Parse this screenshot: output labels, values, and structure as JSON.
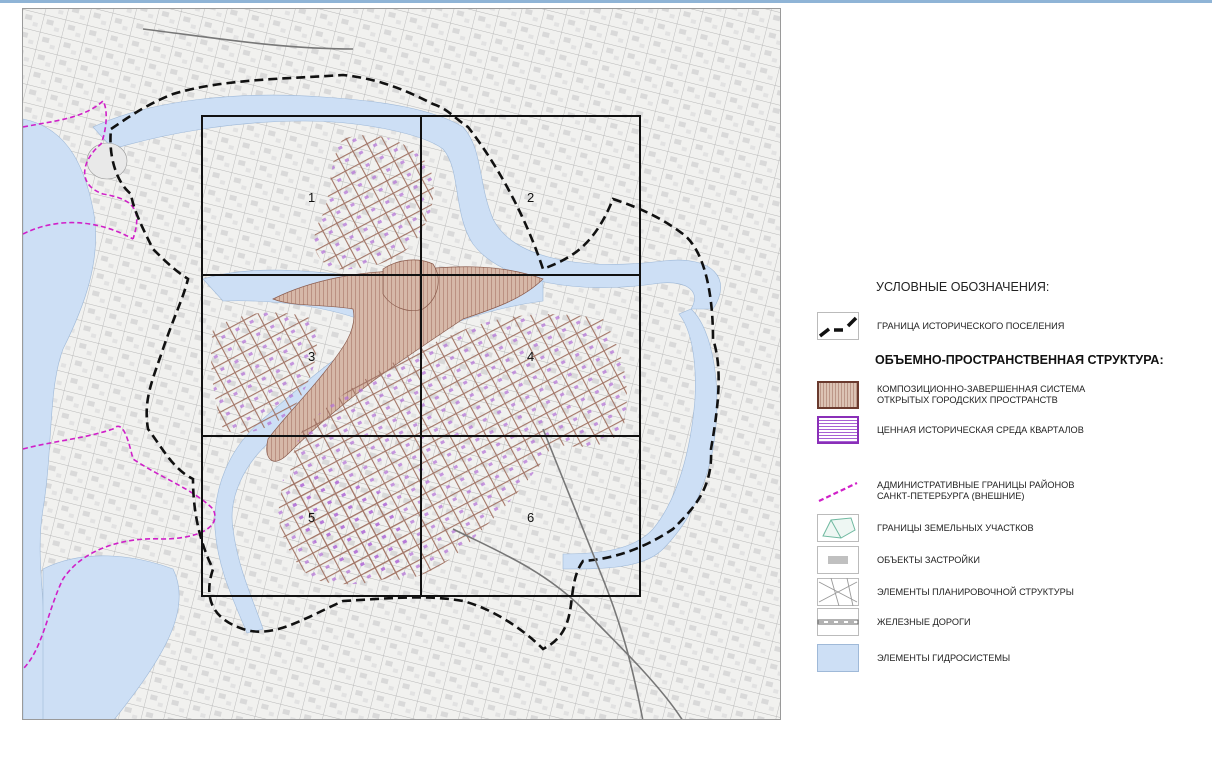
{
  "legend": {
    "title": "УСЛОВНЫЕ ОБОЗНАЧЕНИЯ:",
    "historic_boundary": "ГРАНИЦА ИСТОРИЧЕСКОГО ПОСЕЛЕНИЯ",
    "structure_heading": "ОБЪЕМНО-ПРОСТРАНСТВЕННАЯ СТРУКТУРА:",
    "open_spaces_line1": "КОМПОЗИЦИОННО-ЗАВЕРШЕННАЯ СИСТЕМА",
    "open_spaces_line2": "ОТКРЫТЫХ ГОРОДСКИХ ПРОСТРАНСТВ",
    "historic_blocks": "ЦЕННАЯ ИСТОРИЧЕСКАЯ СРЕДА КВАРТАЛОВ",
    "admin_line1": "АДМИНИСТРАТИВНЫЕ ГРАНИЦЫ РАЙОНОВ",
    "admin_line2": "САНКТ-ПЕТЕРБУРГА (ВНЕШНИЕ)",
    "land_plots": "ГРАНИЦЫ ЗЕМЕЛЬНЫХ УЧАСТКОВ",
    "buildings": "ОБЪЕКТЫ ЗАСТРОЙКИ",
    "planning": "ЭЛЕМЕНТЫ ПЛАНИРОВОЧНОЙ СТРУКТУРЫ",
    "railways": "ЖЕЛЕЗНЫЕ ДОРОГИ",
    "hydro": "ЭЛЕМЕНТЫ ГИДРОСИСТЕМЫ"
  },
  "map": {
    "grid_labels": [
      "1",
      "2",
      "3",
      "4",
      "5",
      "6"
    ]
  },
  "colors": {
    "water": "#cddff5",
    "open_space": "#b98a78",
    "historic_blocks": "#8a2fb8",
    "admin_boundary": "#d020c8",
    "historic_boundary": "#111111"
  }
}
